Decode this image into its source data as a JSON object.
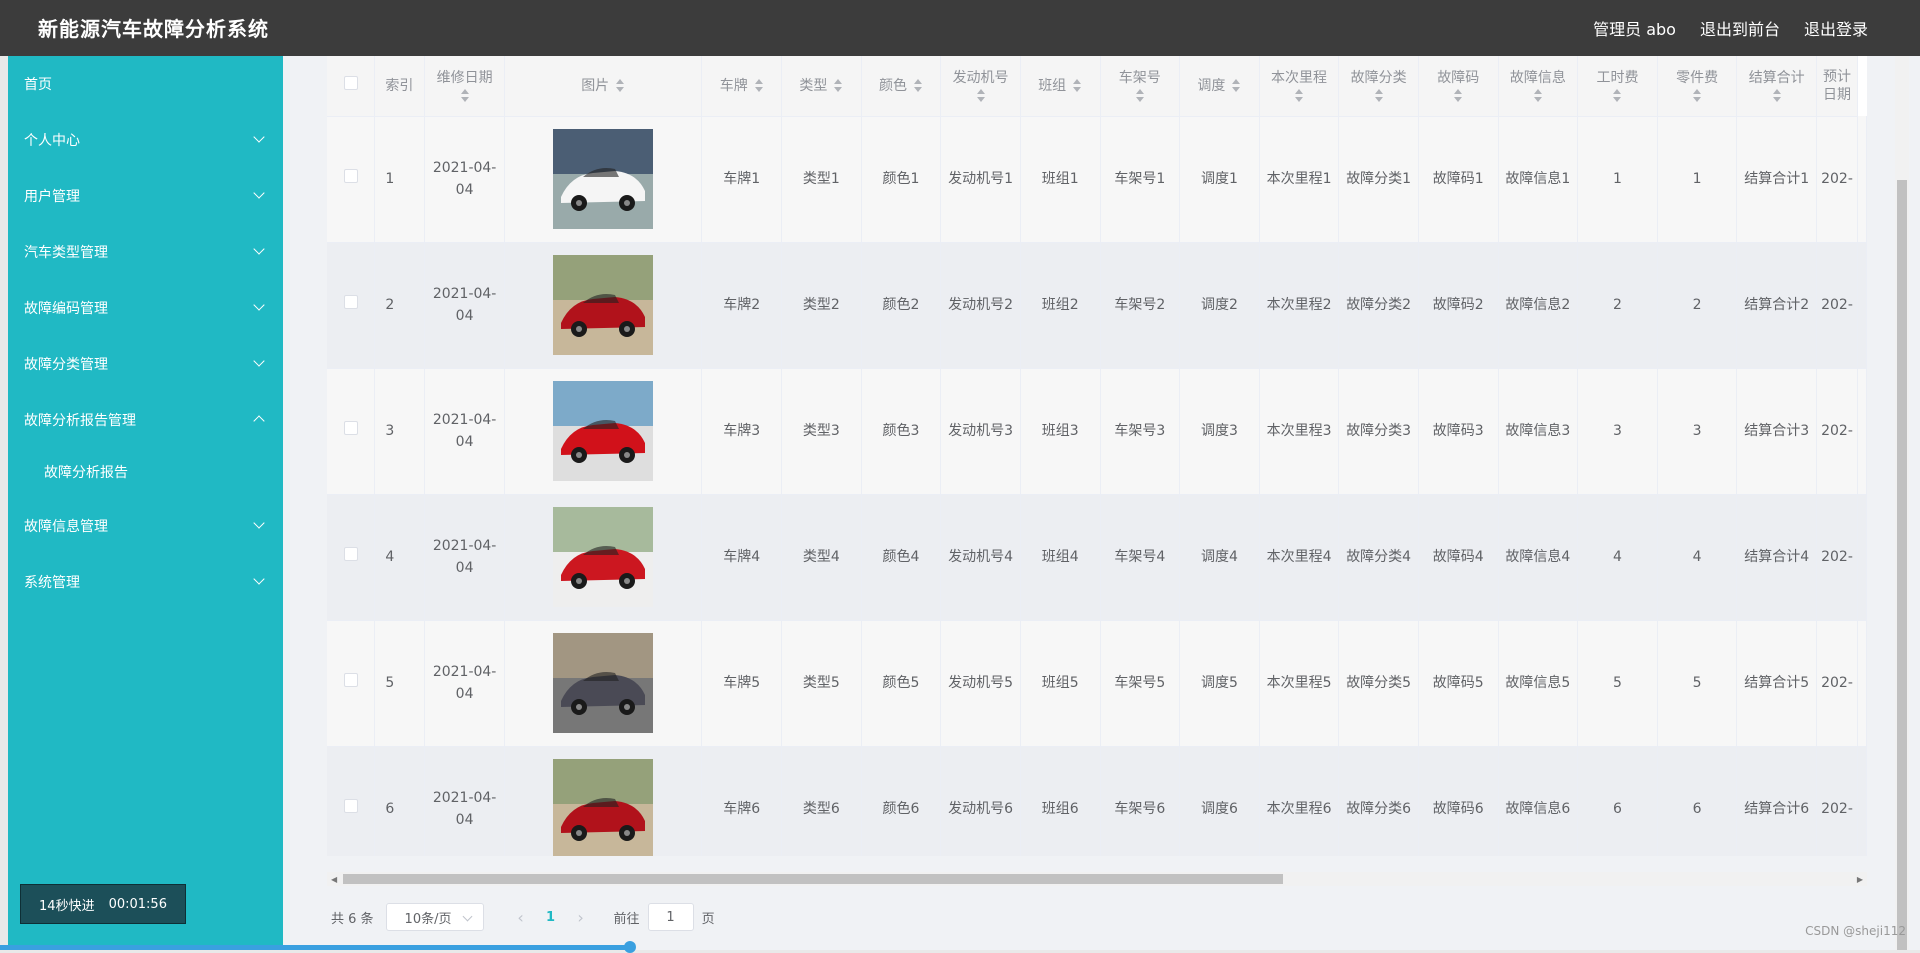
{
  "header": {
    "title": "新能源汽车故障分析系统",
    "user": "管理员 abo",
    "front_link": "退出到前台",
    "logout": "退出登录"
  },
  "sidebar": {
    "items": [
      {
        "label": "首页",
        "expandable": false
      },
      {
        "label": "个人中心",
        "expandable": true
      },
      {
        "label": "用户管理",
        "expandable": true
      },
      {
        "label": "汽车类型管理",
        "expandable": true
      },
      {
        "label": "故障编码管理",
        "expandable": true
      },
      {
        "label": "故障分类管理",
        "expandable": true
      },
      {
        "label": "故障分析报告管理",
        "expandable": true,
        "expanded": true
      },
      {
        "label": "故障分析报告",
        "sub": true
      },
      {
        "label": "故障信息管理",
        "expandable": true
      },
      {
        "label": "系统管理",
        "expandable": true
      }
    ]
  },
  "speed_badge": {
    "label": "14秒快进",
    "time": "00:01:56"
  },
  "table": {
    "headers": [
      "索引",
      "维修日期",
      "图片",
      "车牌",
      "类型",
      "颜色",
      "发动机号",
      "班组",
      "车架号",
      "调度",
      "本次里程",
      "故障分类",
      "故障码",
      "故障信息",
      "工时费",
      "零件费",
      "结算合计",
      "预计日期"
    ],
    "rows": [
      {
        "idx": "1",
        "date": "2021-04-04",
        "plate": "车牌1",
        "type": "类型1",
        "color": "颜色1",
        "engine": "发动机号1",
        "team": "班组1",
        "frame": "车架号1",
        "dispatch": "调度1",
        "mileage": "本次里程1",
        "category": "故障分类1",
        "code": "故障码1",
        "info": "故障信息1",
        "labor": "1",
        "parts": "1",
        "total": "结算合计1",
        "due": "202-"
      },
      {
        "idx": "2",
        "date": "2021-04-04",
        "plate": "车牌2",
        "type": "类型2",
        "color": "颜色2",
        "engine": "发动机号2",
        "team": "班组2",
        "frame": "车架号2",
        "dispatch": "调度2",
        "mileage": "本次里程2",
        "category": "故障分类2",
        "code": "故障码2",
        "info": "故障信息2",
        "labor": "2",
        "parts": "2",
        "total": "结算合计2",
        "due": "202-"
      },
      {
        "idx": "3",
        "date": "2021-04-04",
        "plate": "车牌3",
        "type": "类型3",
        "color": "颜色3",
        "engine": "发动机号3",
        "team": "班组3",
        "frame": "车架号3",
        "dispatch": "调度3",
        "mileage": "本次里程3",
        "category": "故障分类3",
        "code": "故障码3",
        "info": "故障信息3",
        "labor": "3",
        "parts": "3",
        "total": "结算合计3",
        "due": "202-"
      },
      {
        "idx": "4",
        "date": "2021-04-04",
        "plate": "车牌4",
        "type": "类型4",
        "color": "颜色4",
        "engine": "发动机号4",
        "team": "班组4",
        "frame": "车架号4",
        "dispatch": "调度4",
        "mileage": "本次里程4",
        "category": "故障分类4",
        "code": "故障码4",
        "info": "故障信息4",
        "labor": "4",
        "parts": "4",
        "total": "结算合计4",
        "due": "202-"
      },
      {
        "idx": "5",
        "date": "2021-04-04",
        "plate": "车牌5",
        "type": "类型5",
        "color": "颜色5",
        "engine": "发动机号5",
        "team": "班组5",
        "frame": "车架号5",
        "dispatch": "调度5",
        "mileage": "本次里程5",
        "category": "故障分类5",
        "code": "故障码5",
        "info": "故障信息5",
        "labor": "5",
        "parts": "5",
        "total": "结算合计5",
        "due": "202-"
      },
      {
        "idx": "6",
        "date": "2021-04-04",
        "plate": "车牌6",
        "type": "类型6",
        "color": "颜色6",
        "engine": "发动机号6",
        "team": "班组6",
        "frame": "车架号6",
        "dispatch": "调度6",
        "mileage": "本次里程6",
        "category": "故障分类6",
        "code": "故障码6",
        "info": "故障信息6",
        "labor": "6",
        "parts": "6",
        "total": "结算合计6",
        "due": "202-"
      }
    ]
  },
  "pagination": {
    "total": "共 6 条",
    "page_size": "10条/页",
    "current": "1",
    "goto_label": "前往",
    "goto_value": "1",
    "page_unit": "页"
  },
  "watermark": "CSDN @sheji112",
  "colors": {
    "sidebar": "#20b9c4",
    "topbar": "#3c3c3c",
    "accent": "#20b9c4"
  }
}
